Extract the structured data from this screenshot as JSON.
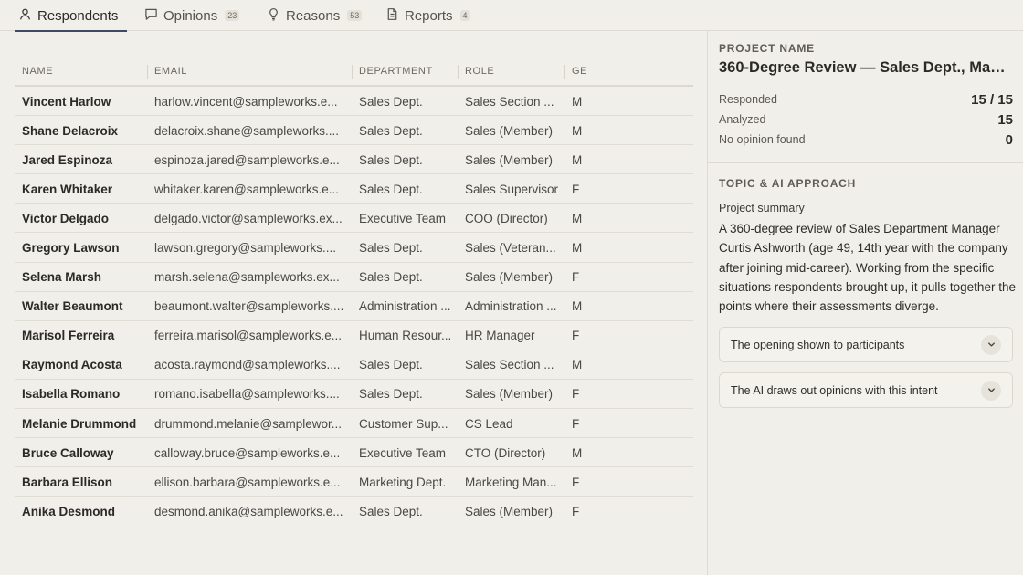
{
  "tabs": [
    {
      "label": "Respondents",
      "count": "",
      "icon": "user-icon",
      "active": true
    },
    {
      "label": "Opinions",
      "count": "23",
      "icon": "chat-bubble-icon",
      "active": false
    },
    {
      "label": "Reasons",
      "count": "53",
      "icon": "lightbulb-icon",
      "active": false
    },
    {
      "label": "Reports",
      "count": "4",
      "icon": "document-icon",
      "active": false
    }
  ],
  "table": {
    "headers": {
      "name": "NAME",
      "email": "EMAIL",
      "department": "DEPARTMENT",
      "role": "ROLE",
      "gender": "GE"
    },
    "rows": [
      {
        "name": "Vincent Harlow",
        "email": "harlow.vincent@sampleworks.e...",
        "department": "Sales Dept.",
        "role": "Sales Section ...",
        "gender": "M"
      },
      {
        "name": "Shane Delacroix",
        "email": "delacroix.shane@sampleworks....",
        "department": "Sales Dept.",
        "role": "Sales (Member)",
        "gender": "M"
      },
      {
        "name": "Jared Espinoza",
        "email": "espinoza.jared@sampleworks.e...",
        "department": "Sales Dept.",
        "role": "Sales (Member)",
        "gender": "M"
      },
      {
        "name": "Karen Whitaker",
        "email": "whitaker.karen@sampleworks.e...",
        "department": "Sales Dept.",
        "role": "Sales Supervisor",
        "gender": "F"
      },
      {
        "name": "Victor Delgado",
        "email": "delgado.victor@sampleworks.ex...",
        "department": "Executive Team",
        "role": "COO (Director)",
        "gender": "M"
      },
      {
        "name": "Gregory Lawson",
        "email": "lawson.gregory@sampleworks....",
        "department": "Sales Dept.",
        "role": "Sales (Veteran...",
        "gender": "M"
      },
      {
        "name": "Selena Marsh",
        "email": "marsh.selena@sampleworks.ex...",
        "department": "Sales Dept.",
        "role": "Sales (Member)",
        "gender": "F"
      },
      {
        "name": "Walter Beaumont",
        "email": "beaumont.walter@sampleworks....",
        "department": "Administration ...",
        "role": "Administration ...",
        "gender": "M"
      },
      {
        "name": "Marisol Ferreira",
        "email": "ferreira.marisol@sampleworks.e...",
        "department": "Human Resour...",
        "role": "HR Manager",
        "gender": "F"
      },
      {
        "name": "Raymond Acosta",
        "email": "acosta.raymond@sampleworks....",
        "department": "Sales Dept.",
        "role": "Sales Section ...",
        "gender": "M"
      },
      {
        "name": "Isabella Romano",
        "email": "romano.isabella@sampleworks....",
        "department": "Sales Dept.",
        "role": "Sales (Member)",
        "gender": "F"
      },
      {
        "name": "Melanie Drummond",
        "email": "drummond.melanie@samplewor...",
        "department": "Customer Sup...",
        "role": "CS Lead",
        "gender": "F"
      },
      {
        "name": "Bruce Calloway",
        "email": "calloway.bruce@sampleworks.e...",
        "department": "Executive Team",
        "role": "CTO (Director)",
        "gender": "M"
      },
      {
        "name": "Barbara Ellison",
        "email": "ellison.barbara@sampleworks.e...",
        "department": "Marketing Dept.",
        "role": "Marketing Man...",
        "gender": "F"
      },
      {
        "name": "Anika Desmond",
        "email": "desmond.anika@sampleworks.e...",
        "department": "Sales Dept.",
        "role": "Sales (Member)",
        "gender": "F"
      }
    ]
  },
  "panel": {
    "project_label": "PROJECT NAME",
    "project_name": "360-Degree Review — Sales Dept., Mana...",
    "stats": [
      {
        "label": "Responded",
        "value": "15 / 15"
      },
      {
        "label": "Analyzed",
        "value": "15"
      },
      {
        "label": "No opinion found",
        "value": "0"
      }
    ],
    "topic_label": "TOPIC & AI APPROACH",
    "summary_label": "Project summary",
    "summary_text": "A 360-degree review of Sales Department Manager Curtis Ashworth (age 49, 14th year with the company after joining mid-career). Working from the specific situations respondents brought up, it pulls together the points where their assessments diverge.",
    "accordions": [
      {
        "label": "The opening shown to participants",
        "icon": "chevron-down-icon"
      },
      {
        "label": "The AI draws out opinions with this intent",
        "icon": "chevron-down-icon"
      }
    ]
  }
}
